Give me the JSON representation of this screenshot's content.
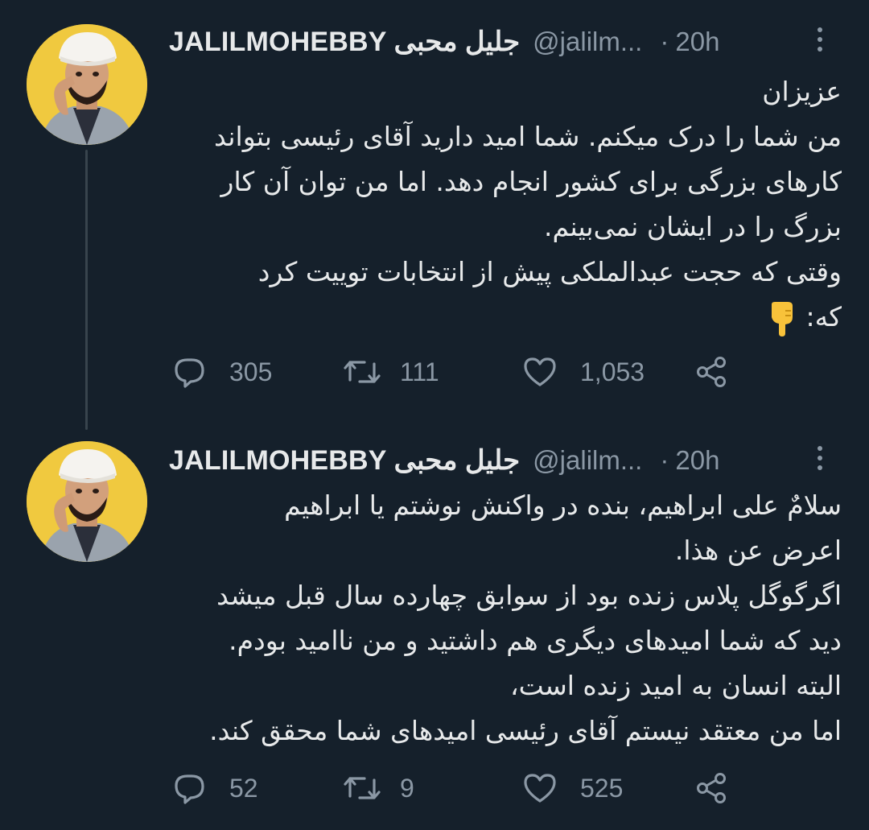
{
  "tweets": [
    {
      "display_name": "JALILMOHEBBY جلیل محبی",
      "handle": "@jalilm...",
      "separator": "·",
      "time": "20h",
      "text_lines": [
        "عزیزان",
        "من شما را درک میکنم. شما امید دارید آقای رئیسی بتواند",
        "کارهای بزرگی برای کشور انجام دهد. اما من توان آن کار",
        "بزرگ را در ایشان نمی‌بینم.",
        "وقتی که حجت عبدالملکی پیش از انتخابات توییت کرد",
        "که:"
      ],
      "emoji_icon": "backhand-index-pointing-down",
      "replies": "305",
      "retweets": "111",
      "likes": "1,053"
    },
    {
      "display_name": "JALILMOHEBBY جلیل محبی",
      "handle": "@jalilm...",
      "separator": "·",
      "time": "20h",
      "text_lines": [
        "سلامٌ علی ابراهیم، بنده در واکنش نوشتم یا ابراهیم",
        "اعرض عن هذا.",
        "اگرگوگل پلاس زنده بود از سوابق چهارده سال قبل میشد",
        "دید که شما امیدهای دیگری هم داشتید و من ناامید بودم.",
        "البته انسان به امید زنده است،",
        "اما من معتقد نیستم آقای رئیسی امیدهای شما محقق کند."
      ],
      "replies": "52",
      "retweets": "9",
      "likes": "525"
    }
  ],
  "colors": {
    "background": "#15202b",
    "text": "#e7e9ea",
    "muted": "#8b98a5",
    "thread_line": "#38444d",
    "avatar_bg": "#f0c93f"
  }
}
